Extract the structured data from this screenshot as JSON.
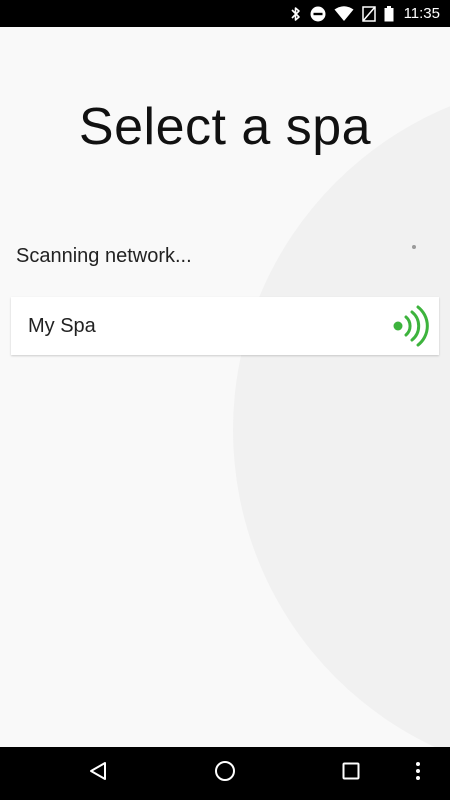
{
  "status_bar": {
    "time": "11:35",
    "icons": [
      "bluetooth-icon",
      "do-not-disturb-icon",
      "wifi-icon",
      "no-sim-icon",
      "battery-icon"
    ]
  },
  "page": {
    "title": "Select a spa",
    "scanning_text": "Scanning network...",
    "accent_color": "#3db33d",
    "spas": [
      {
        "name": "My Spa",
        "icon": "wifi-signal-icon"
      }
    ]
  },
  "nav_bar": {
    "buttons": [
      "back-icon",
      "home-icon",
      "recents-icon",
      "more-icon"
    ]
  }
}
